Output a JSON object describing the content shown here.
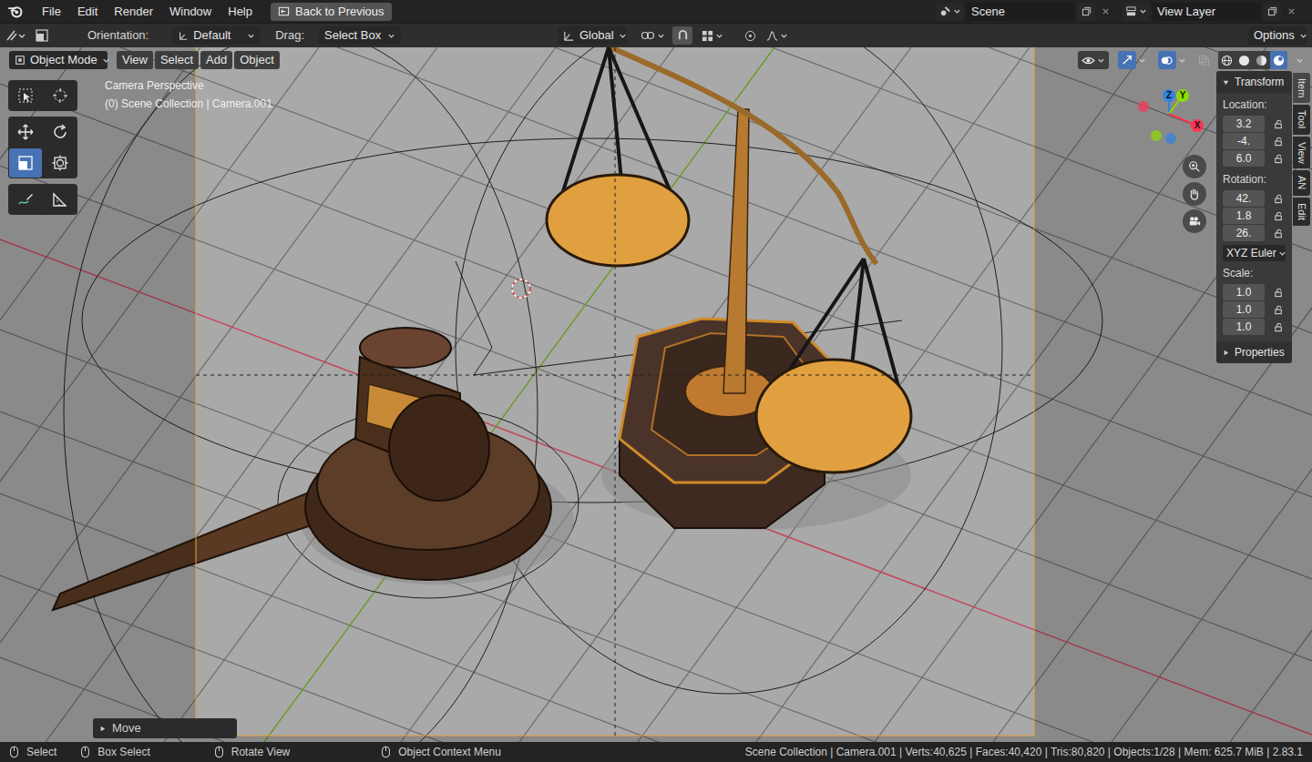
{
  "menu_bar": {
    "items": [
      "File",
      "Edit",
      "Render",
      "Window",
      "Help"
    ],
    "back_button": "Back to Previous",
    "scene": "Scene",
    "view_layer": "View Layer"
  },
  "tool_header": {
    "orientation_label": "Orientation:",
    "orientation": "Default",
    "drag_label": "Drag:",
    "drag": "Select Box",
    "transform_orientation": "Global",
    "options": "Options"
  },
  "viewport_header": {
    "mode": "Object Mode",
    "menus": [
      "View",
      "Select",
      "Add",
      "Object"
    ],
    "shading": [
      {
        "kind": "wireframe",
        "selected": false
      },
      {
        "kind": "solid",
        "selected": false
      },
      {
        "kind": "material",
        "selected": false
      },
      {
        "kind": "rendered",
        "selected": true
      }
    ]
  },
  "overlay": {
    "view": "Camera Perspective",
    "info": "(0) Scene Collection | Camera.001"
  },
  "toolbar": [
    {
      "kind": "select",
      "selected": false
    },
    {
      "kind": "cursor",
      "selected": false
    },
    {
      "kind": "move",
      "selected": false
    },
    {
      "kind": "rotate",
      "selected": false
    },
    {
      "kind": "scale",
      "selected": true
    },
    {
      "kind": "transform",
      "selected": false
    },
    {
      "kind": "annotate",
      "selected": false
    },
    {
      "kind": "measure",
      "selected": false
    }
  ],
  "gizmo": {
    "axes": [
      {
        "label": "Z",
        "color": "#2f83e3"
      },
      {
        "label": "Y",
        "color": "#8bdc00"
      },
      {
        "label": "X",
        "color": "#ff3352"
      }
    ]
  },
  "sidebar": {
    "tabs": [
      {
        "label": "Item",
        "selected": true
      },
      {
        "label": "Tool",
        "selected": false
      },
      {
        "label": "View",
        "selected": false
      },
      {
        "label": "AN",
        "selected": false
      },
      {
        "label": "Edit",
        "selected": false
      }
    ],
    "panels": [
      {
        "title": "Transform",
        "expanded": true
      },
      {
        "title": "Properties",
        "expanded": false
      }
    ],
    "location_label": "Location:",
    "location": [
      "3.2",
      "-4.",
      "6.0"
    ],
    "rotation_label": "Rotation:",
    "rotation": [
      "42.",
      "1.8",
      "26."
    ],
    "rotation_mode": "XYZ Euler",
    "scale_label": "Scale:",
    "scale": [
      "1.0",
      "1.0",
      "1.0"
    ]
  },
  "operator_panel": {
    "title": "Move",
    "expanded": false
  },
  "status_bar": {
    "hints": [
      "Select",
      "Box Select",
      "Rotate View",
      "Object Context Menu"
    ],
    "stats": "Scene Collection | Camera.001 | Verts:40,625 | Faces:40,420 | Tris:80,820 | Objects:1/28 | Mem: 625.7 MiB | 2.83.1"
  }
}
